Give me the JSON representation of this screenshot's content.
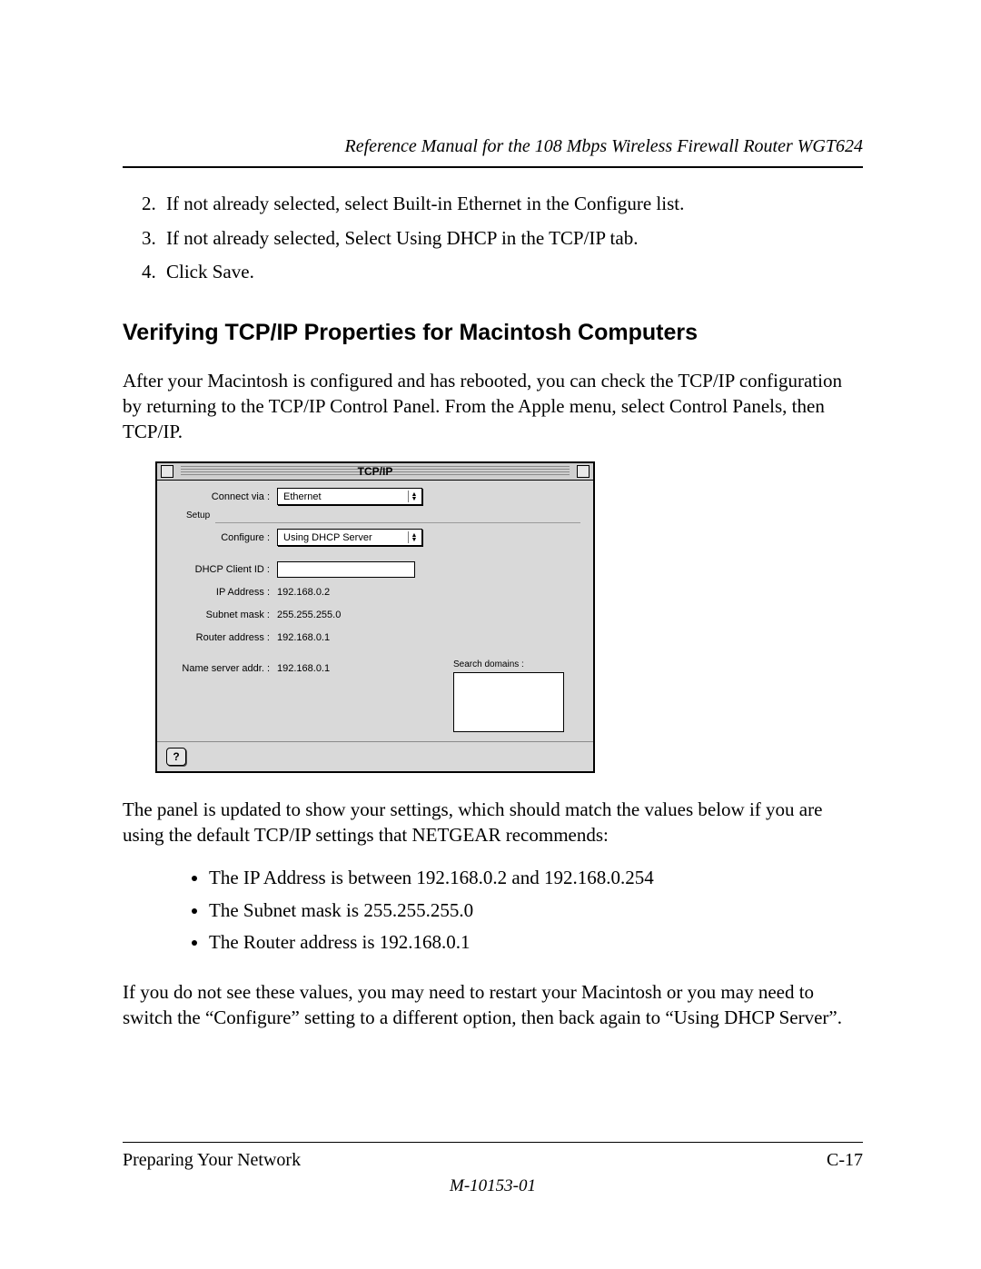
{
  "header": {
    "title": "Reference Manual for the 108 Mbps Wireless Firewall Router WGT624"
  },
  "steps": {
    "s2": "If not already selected, select Built-in Ethernet in the Configure list.",
    "s3": "If not already selected, Select Using DHCP in the TCP/IP tab.",
    "s4": "Click Save."
  },
  "heading": "Verifying TCP/IP Properties for Macintosh Computers",
  "para1": "After your Macintosh is configured and has rebooted, you can check the TCP/IP configuration by returning to the TCP/IP Control Panel. From the Apple menu, select Control Panels, then TCP/IP.",
  "tcpip": {
    "title": "TCP/IP",
    "labels": {
      "connect_via": "Connect via :",
      "setup": "Setup",
      "configure": "Configure :",
      "dhcp_client_id": "DHCP Client ID :",
      "ip_address": "IP Address :",
      "subnet_mask": "Subnet mask :",
      "router_address": "Router address :",
      "name_server": "Name server addr. :",
      "search_domains": "Search domains :"
    },
    "values": {
      "connect_via": "Ethernet",
      "configure": "Using DHCP Server",
      "dhcp_client_id": "",
      "ip_address": "192.168.0.2",
      "subnet_mask": "255.255.255.0",
      "router_address": "192.168.0.1",
      "name_server": "192.168.0.1"
    },
    "help_glyph": "?"
  },
  "para2": "The panel is updated to show your settings, which should match the values below if you are using the default TCP/IP settings that NETGEAR recommends:",
  "bullets": {
    "b1": "The IP Address is between 192.168.0.2 and 192.168.0.254",
    "b2": "The Subnet mask is 255.255.255.0",
    "b3": "The Router address is 192.168.0.1"
  },
  "para3": "If you do not see these values, you may need to restart your Macintosh or you may need to switch the “Configure” setting to a different option, then back again to “Using DHCP Server”.",
  "footer": {
    "left": "Preparing Your Network",
    "right": "C-17",
    "docnum": "M-10153-01"
  }
}
